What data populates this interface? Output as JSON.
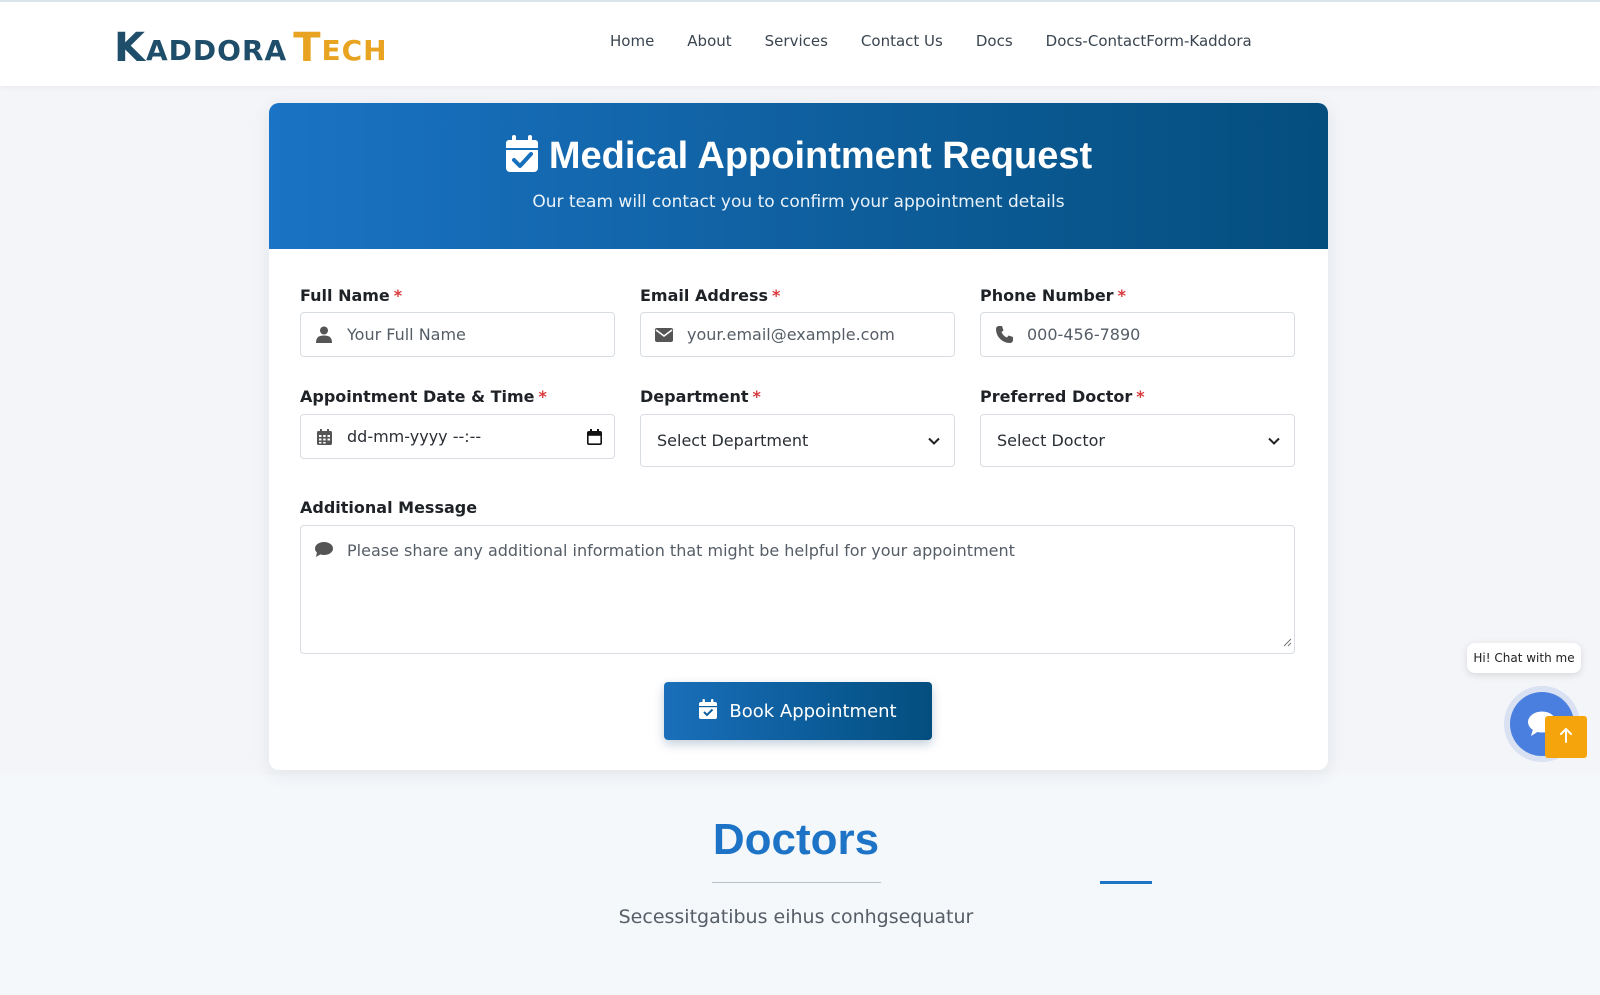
{
  "header": {
    "logo": {
      "first_initial": "K",
      "first_rest": "ADDORA",
      "second_initial": "T",
      "second_rest": "ECH"
    },
    "nav": [
      "Home",
      "About",
      "Services",
      "Contact Us",
      "Docs",
      "Docs-ContactForm-Kaddora"
    ]
  },
  "form": {
    "title": "Medical Appointment Request",
    "subtitle": "Our team will contact you to confirm your appointment details",
    "required_mark": "*",
    "full_name": {
      "label": "Full Name",
      "placeholder": "Your Full Name",
      "icon": "user-icon"
    },
    "email": {
      "label": "Email Address",
      "placeholder": "your.email@example.com",
      "icon": "envelope-icon"
    },
    "phone": {
      "label": "Phone Number",
      "placeholder": "000-456-7890",
      "icon": "phone-icon"
    },
    "datetime": {
      "label": "Appointment Date & Time",
      "placeholder": "dd-mm-yyyy --:--",
      "icon": "calendar-grid-icon"
    },
    "department": {
      "label": "Department",
      "selected": "Select Department"
    },
    "doctor": {
      "label": "Preferred Doctor",
      "selected": "Select Doctor"
    },
    "message": {
      "label": "Additional Message",
      "placeholder": "Please share any additional information that might be helpful for your appointment",
      "icon": "comment-icon"
    },
    "submit_label": "Book Appointment"
  },
  "doctors": {
    "title": "Doctors",
    "subtitle": "Secessitgatibus eihus conhgsequatur"
  },
  "chat": {
    "bubble": "Hi! Chat with me"
  },
  "colors": {
    "primary": "#1d74c6",
    "header_gradient_start": "#1a73c4",
    "header_gradient_end": "#044e7e",
    "required": "#d93a3a",
    "scroll_top": "#f5a40c",
    "logo_dark": "#1f4e6b",
    "logo_accent": "#e8a321"
  }
}
